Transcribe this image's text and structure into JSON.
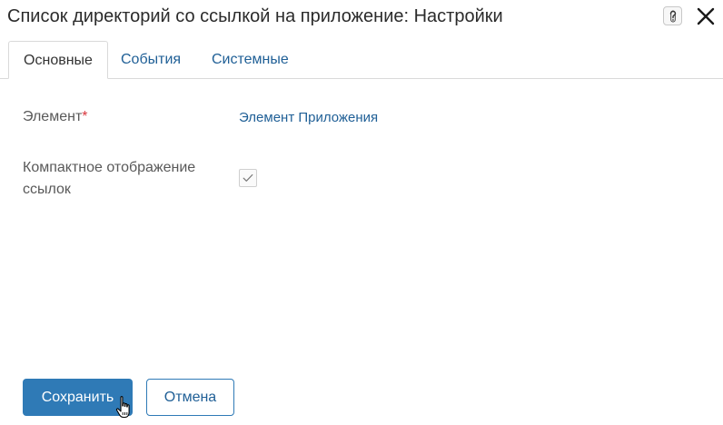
{
  "dialog": {
    "title": "Список директорий со ссылкой на приложение: Настройки",
    "help_icon": "help-icon",
    "close_icon": "close-icon"
  },
  "tabs": [
    {
      "label": "Основные",
      "active": true
    },
    {
      "label": "События",
      "active": false
    },
    {
      "label": "Системные",
      "active": false
    }
  ],
  "form": {
    "element": {
      "label": "Элемент",
      "required_mark": "*",
      "value": "Элемент Приложения"
    },
    "compact_links": {
      "label_line1": "Компактное отображение",
      "label_line2": "ссылок",
      "checked": true
    }
  },
  "actions": {
    "save_label": "Сохранить",
    "cancel_label": "Отмена"
  },
  "colors": {
    "primary": "#2f7ab6",
    "link": "#1f5f96",
    "required": "#d9363e"
  }
}
